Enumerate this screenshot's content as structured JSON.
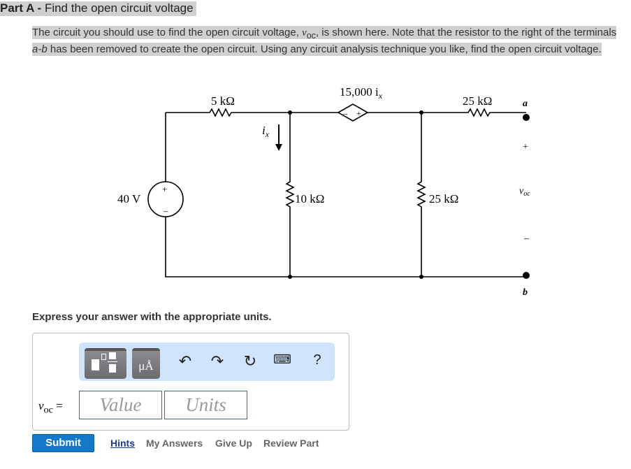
{
  "part": {
    "label": "Part A -",
    "title": "Find the open circuit voltage"
  },
  "description": {
    "pre": "The circuit you should use to find the open circuit voltage, ",
    "var": "v",
    "sub": "oc",
    "post": ", is shown here. Note that the resistor to the right of the terminals ",
    "ab": "a-b",
    "post2": " has been removed to create the open circuit. Using any circuit analysis technique you like, find the open circuit voltage."
  },
  "circuit": {
    "r1": "5 kΩ",
    "source": "40 V",
    "ix": "i",
    "ix_sub": "x",
    "r2": "10 kΩ",
    "dep": "15,000 i",
    "dep_sub": "x",
    "r3": "25 kΩ",
    "r4": "25 kΩ",
    "a": "a",
    "b": "b",
    "plus": "+",
    "minus": "–",
    "voc": "v",
    "voc_sub": "oc"
  },
  "instruction": "Express your answer with the appropriate units.",
  "answer": {
    "label_var": "v",
    "label_sub": "oc",
    "eq": " =",
    "value_placeholder": "Value",
    "units_placeholder": "Units"
  },
  "toolbar": {
    "units_icon_text": "μÅ",
    "help": "?"
  },
  "actions": {
    "submit": "Submit",
    "hints": "Hints",
    "my_answers": "My Answers",
    "give_up": "Give Up",
    "review": "Review Part"
  }
}
